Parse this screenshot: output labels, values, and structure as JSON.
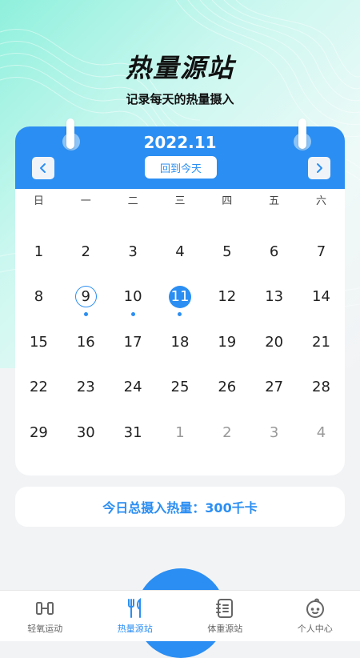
{
  "header": {
    "title": "热量源站",
    "subtitle": "记录每天的热量摄入"
  },
  "calendar": {
    "month": "2022.11",
    "today_button": "回到今天",
    "prev_icon": "chevron-left-icon",
    "next_icon": "chevron-right-icon",
    "weekdays": [
      "日",
      "一",
      "二",
      "三",
      "四",
      "五",
      "六"
    ],
    "days": [
      {
        "label": "1",
        "in_month": true,
        "ringed": false,
        "selected": false,
        "dot": false
      },
      {
        "label": "2",
        "in_month": true,
        "ringed": false,
        "selected": false,
        "dot": false
      },
      {
        "label": "3",
        "in_month": true,
        "ringed": false,
        "selected": false,
        "dot": false
      },
      {
        "label": "4",
        "in_month": true,
        "ringed": false,
        "selected": false,
        "dot": false
      },
      {
        "label": "5",
        "in_month": true,
        "ringed": false,
        "selected": false,
        "dot": false
      },
      {
        "label": "6",
        "in_month": true,
        "ringed": false,
        "selected": false,
        "dot": false
      },
      {
        "label": "7",
        "in_month": true,
        "ringed": false,
        "selected": false,
        "dot": false
      },
      {
        "label": "8",
        "in_month": true,
        "ringed": false,
        "selected": false,
        "dot": false
      },
      {
        "label": "9",
        "in_month": true,
        "ringed": true,
        "selected": false,
        "dot": true
      },
      {
        "label": "10",
        "in_month": true,
        "ringed": false,
        "selected": false,
        "dot": true
      },
      {
        "label": "11",
        "in_month": true,
        "ringed": false,
        "selected": true,
        "dot": true
      },
      {
        "label": "12",
        "in_month": true,
        "ringed": false,
        "selected": false,
        "dot": false
      },
      {
        "label": "13",
        "in_month": true,
        "ringed": false,
        "selected": false,
        "dot": false
      },
      {
        "label": "14",
        "in_month": true,
        "ringed": false,
        "selected": false,
        "dot": false
      },
      {
        "label": "15",
        "in_month": true,
        "ringed": false,
        "selected": false,
        "dot": false
      },
      {
        "label": "16",
        "in_month": true,
        "ringed": false,
        "selected": false,
        "dot": false
      },
      {
        "label": "17",
        "in_month": true,
        "ringed": false,
        "selected": false,
        "dot": false
      },
      {
        "label": "18",
        "in_month": true,
        "ringed": false,
        "selected": false,
        "dot": false
      },
      {
        "label": "19",
        "in_month": true,
        "ringed": false,
        "selected": false,
        "dot": false
      },
      {
        "label": "20",
        "in_month": true,
        "ringed": false,
        "selected": false,
        "dot": false
      },
      {
        "label": "21",
        "in_month": true,
        "ringed": false,
        "selected": false,
        "dot": false
      },
      {
        "label": "22",
        "in_month": true,
        "ringed": false,
        "selected": false,
        "dot": false
      },
      {
        "label": "23",
        "in_month": true,
        "ringed": false,
        "selected": false,
        "dot": false
      },
      {
        "label": "24",
        "in_month": true,
        "ringed": false,
        "selected": false,
        "dot": false
      },
      {
        "label": "25",
        "in_month": true,
        "ringed": false,
        "selected": false,
        "dot": false
      },
      {
        "label": "26",
        "in_month": true,
        "ringed": false,
        "selected": false,
        "dot": false
      },
      {
        "label": "27",
        "in_month": true,
        "ringed": false,
        "selected": false,
        "dot": false
      },
      {
        "label": "28",
        "in_month": true,
        "ringed": false,
        "selected": false,
        "dot": false
      },
      {
        "label": "29",
        "in_month": true,
        "ringed": false,
        "selected": false,
        "dot": false
      },
      {
        "label": "30",
        "in_month": true,
        "ringed": false,
        "selected": false,
        "dot": false
      },
      {
        "label": "31",
        "in_month": true,
        "ringed": false,
        "selected": false,
        "dot": false
      },
      {
        "label": "1",
        "in_month": false,
        "ringed": false,
        "selected": false,
        "dot": false
      },
      {
        "label": "2",
        "in_month": false,
        "ringed": false,
        "selected": false,
        "dot": false
      },
      {
        "label": "3",
        "in_month": false,
        "ringed": false,
        "selected": false,
        "dot": false
      },
      {
        "label": "4",
        "in_month": false,
        "ringed": false,
        "selected": false,
        "dot": false
      }
    ]
  },
  "summary": {
    "total_text": "今日总摄入热量：300千卡"
  },
  "tabbar": {
    "tabs": [
      {
        "label": "轻氧运动",
        "icon": "dumbbell-icon",
        "active": false
      },
      {
        "label": "热量源站",
        "icon": "fork-knife-icon",
        "active": true
      },
      {
        "label": "体重源站",
        "icon": "notebook-icon",
        "active": false
      },
      {
        "label": "个人中心",
        "icon": "face-icon",
        "active": false
      }
    ]
  },
  "colors": {
    "accent": "#2b8ef2",
    "background": "#f2f3f5",
    "hero_gradient_start": "#8ff0dc"
  }
}
